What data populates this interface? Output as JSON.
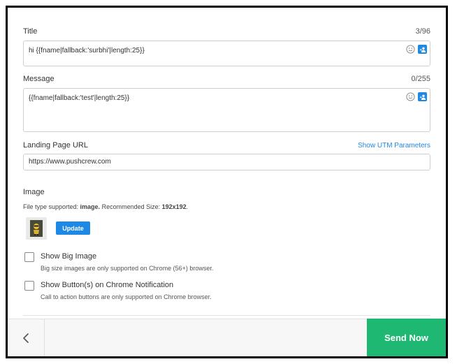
{
  "title_field": {
    "label": "Title",
    "counter": "3/96",
    "value": "hi {{fname|fallback:'surbhi'|length:25}}"
  },
  "message_field": {
    "label": "Message",
    "counter": "0/255",
    "value": "{{fname|fallback:'test'|length:25}}"
  },
  "landing_url": {
    "label": "Landing Page URL",
    "link": "Show UTM Parameters",
    "value": "https://www.pushcrew.com"
  },
  "image": {
    "title": "Image",
    "note_prefix": "File type supported: ",
    "note_type": "image.",
    "note_mid": " Recommended Size: ",
    "note_size": "192x192",
    "note_suffix": ".",
    "update_label": "Update"
  },
  "big_image": {
    "label": "Show Big Image",
    "help": "Big size images are only supported on Chrome (56+) browser."
  },
  "buttons_option": {
    "label": "Show Button(s) on Chrome Notification",
    "help": "Call to action buttons are only supported on Chrome browser."
  },
  "footer": {
    "send_label": "Send Now"
  },
  "colors": {
    "accent": "#1e88e5",
    "send": "#1fb872"
  },
  "icons": {
    "emoji": "smile-icon",
    "personalize": "person-add-icon",
    "back": "chevron-left-icon"
  }
}
